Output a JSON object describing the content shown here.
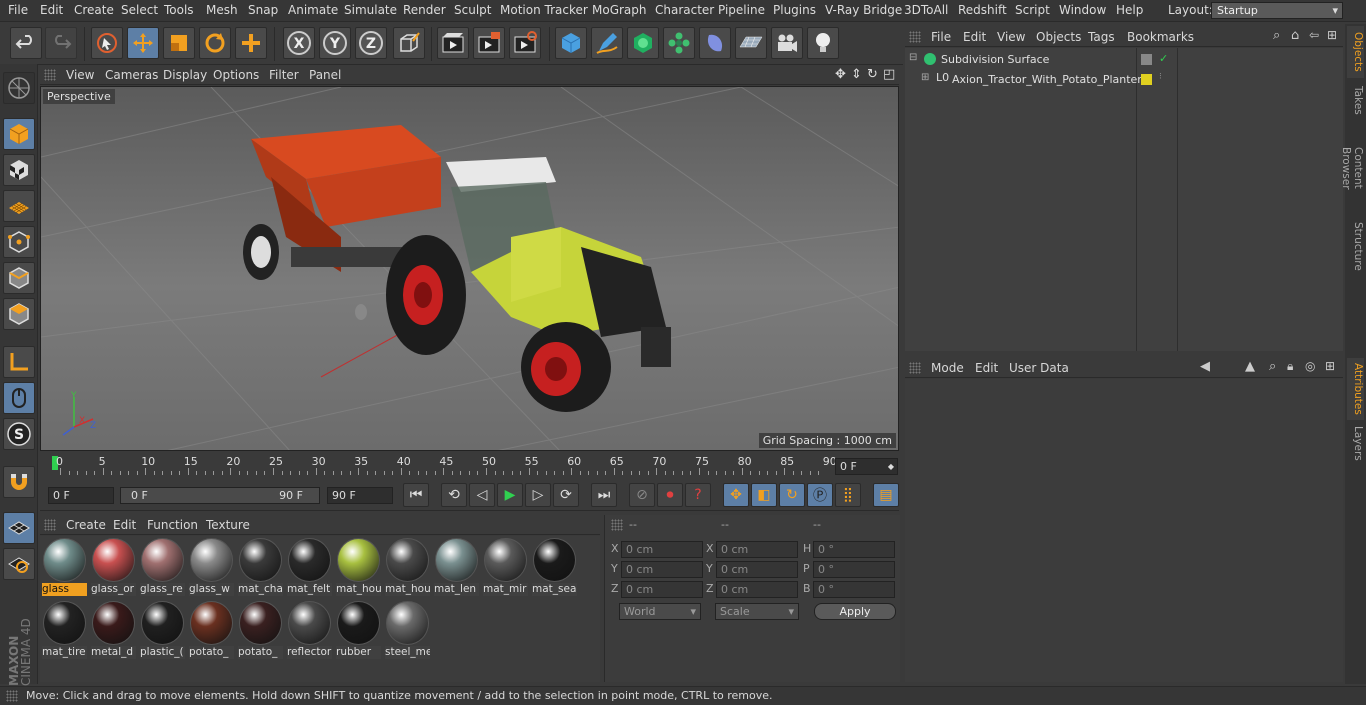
{
  "menubar": {
    "items": [
      "File",
      "Edit",
      "Create",
      "Select",
      "Tools",
      "Mesh",
      "Snap",
      "Animate",
      "Simulate",
      "Render",
      "Sculpt",
      "Motion Tracker",
      "MoGraph",
      "Character",
      "Pipeline",
      "Plugins",
      "V-Ray Bridge",
      "3DToAll",
      "Redshift",
      "Script",
      "Window",
      "Help"
    ],
    "layout_label": "Layout:",
    "layout_value": "Startup"
  },
  "toolbar": {
    "icons": [
      "undo-icon",
      "redo-icon",
      "live-selection-icon",
      "move-icon",
      "scale-icon",
      "rotate-icon",
      "recent-tools-icon",
      "x-axis-icon",
      "y-axis-icon",
      "z-axis-icon",
      "coordinate-system-icon",
      "render-view-icon",
      "render-to-picture-viewer-icon",
      "render-settings-icon",
      "cube-icon",
      "pen-icon",
      "subdivision-icon",
      "array-icon",
      "deformer-icon",
      "floor-icon",
      "camera-icon",
      "light-icon"
    ],
    "axis_labels": [
      "X",
      "Y",
      "Z"
    ]
  },
  "viewport": {
    "menu": [
      "View",
      "Cameras",
      "Display",
      "Options",
      "Filter",
      "Panel"
    ],
    "label": "Perspective",
    "grid_spacing": "Grid Spacing : 1000 cm",
    "axis_labels": [
      "Y",
      "X",
      "Z"
    ]
  },
  "timeline": {
    "ticks": [
      "0",
      "5",
      "10",
      "15",
      "20",
      "25",
      "30",
      "35",
      "40",
      "45",
      "50",
      "55",
      "60",
      "65",
      "70",
      "75",
      "80",
      "85",
      "90"
    ],
    "current_frame": "0 F"
  },
  "transport": {
    "start": "0 F",
    "range_start": "0 F",
    "range_end": "90 F",
    "end": "90 F"
  },
  "materials": {
    "menu": [
      "Create",
      "Edit",
      "Function",
      "Texture"
    ],
    "items": [
      {
        "name": "glass",
        "color": "#6f8c8a",
        "selected": true
      },
      {
        "name": "glass_or",
        "color": "#c85050",
        "selected": false
      },
      {
        "name": "glass_re",
        "color": "#a07070",
        "selected": false
      },
      {
        "name": "glass_w",
        "color": "#8a8a8a",
        "selected": false
      },
      {
        "name": "mat_cha",
        "color": "#3a3a3a",
        "selected": false
      },
      {
        "name": "mat_felt",
        "color": "#2a2a2a",
        "selected": false
      },
      {
        "name": "mat_hou",
        "color": "#a8c040",
        "selected": false
      },
      {
        "name": "mat_hou",
        "color": "#4a4a4a",
        "selected": false
      },
      {
        "name": "mat_len",
        "color": "#7a9090",
        "selected": false
      },
      {
        "name": "mat_mir",
        "color": "#5a5a5a",
        "selected": false
      },
      {
        "name": "mat_sea",
        "color": "#1a1a1a",
        "selected": false
      },
      {
        "name": "mat_tire",
        "color": "#222222",
        "selected": false
      },
      {
        "name": "metal_d",
        "color": "#3a1a1a",
        "selected": false
      },
      {
        "name": "plastic_(",
        "color": "#202020",
        "selected": false
      },
      {
        "name": "potato_",
        "color": "#6a3020",
        "selected": false
      },
      {
        "name": "potato_",
        "color": "#3a2020",
        "selected": false
      },
      {
        "name": "reflector",
        "color": "#4a4a4a",
        "selected": false
      },
      {
        "name": "rubber",
        "color": "#1a1a1a",
        "selected": false
      },
      {
        "name": "steel_me",
        "color": "#6a6a6a",
        "selected": false
      }
    ]
  },
  "coordinates": {
    "headers": [
      "--",
      "--",
      "--"
    ],
    "rows": [
      {
        "a": "X",
        "av": "0 cm",
        "b": "X",
        "bv": "0 cm",
        "c": "H",
        "cv": "0 °"
      },
      {
        "a": "Y",
        "av": "0 cm",
        "b": "Y",
        "bv": "0 cm",
        "c": "P",
        "cv": "0 °"
      },
      {
        "a": "Z",
        "av": "0 cm",
        "b": "Z",
        "bv": "0 cm",
        "c": "B",
        "cv": "0 °"
      }
    ],
    "space": "World",
    "mode": "Scale",
    "apply": "Apply"
  },
  "objects": {
    "menu": [
      "File",
      "Edit",
      "View",
      "Objects",
      "Tags",
      "Bookmarks"
    ],
    "items": [
      {
        "name": "Subdivision Surface"
      },
      {
        "name": "Axion_Tractor_With_Potato_Planter"
      }
    ]
  },
  "attributes": {
    "menu": [
      "Mode",
      "Edit",
      "User Data"
    ]
  },
  "right_tabs": [
    {
      "label": "Objects",
      "active": true
    },
    {
      "label": "Takes",
      "active": false
    },
    {
      "label": "Content Browser",
      "active": false
    },
    {
      "label": "Structure",
      "active": false
    },
    {
      "label": "Attributes",
      "active": true
    },
    {
      "label": "Layers",
      "active": false
    }
  ],
  "status": "Move: Click and drag to move elements. Hold down SHIFT to quantize movement / add to the selection in point mode, CTRL to remove.",
  "brand": {
    "line1": "MAXON",
    "line2": "CINEMA 4D"
  }
}
